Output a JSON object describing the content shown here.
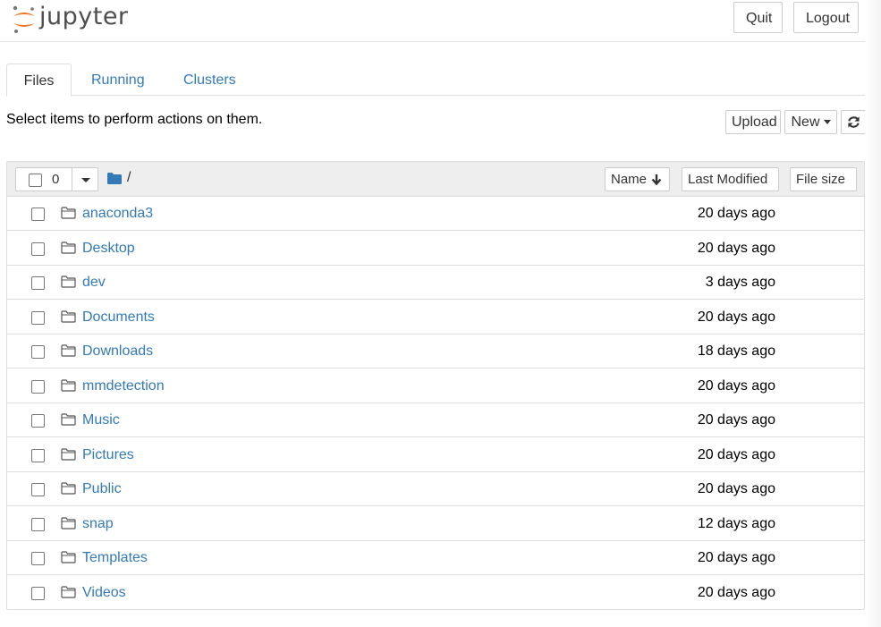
{
  "header": {
    "logo_text": "jupyter",
    "quit_label": "Quit",
    "logout_label": "Logout",
    "logo_colors": {
      "orange": "#f37726",
      "gray": "#767677"
    }
  },
  "tabs": [
    {
      "label": "Files",
      "active": true
    },
    {
      "label": "Running",
      "active": false
    },
    {
      "label": "Clusters",
      "active": false
    }
  ],
  "toolbar": {
    "instructions": "Select items to perform actions on them.",
    "upload_label": "Upload",
    "new_label": "New",
    "refresh_icon": "refresh-icon"
  },
  "file_list": {
    "selected_count": "0",
    "path": "/",
    "columns": {
      "name": "Name",
      "last_modified": "Last Modified",
      "file_size": "File size"
    },
    "items": [
      {
        "name": "anaconda3",
        "modified": "20 days ago",
        "icon": "folder-icon"
      },
      {
        "name": "Desktop",
        "modified": "20 days ago",
        "icon": "folder-icon"
      },
      {
        "name": "dev",
        "modified": "3 days ago",
        "icon": "folder-icon"
      },
      {
        "name": "Documents",
        "modified": "20 days ago",
        "icon": "folder-icon"
      },
      {
        "name": "Downloads",
        "modified": "18 days ago",
        "icon": "folder-icon"
      },
      {
        "name": "mmdetection",
        "modified": "20 days ago",
        "icon": "folder-icon"
      },
      {
        "name": "Music",
        "modified": "20 days ago",
        "icon": "folder-icon"
      },
      {
        "name": "Pictures",
        "modified": "20 days ago",
        "icon": "folder-icon"
      },
      {
        "name": "Public",
        "modified": "20 days ago",
        "icon": "folder-icon"
      },
      {
        "name": "snap",
        "modified": "12 days ago",
        "icon": "folder-icon"
      },
      {
        "name": "Templates",
        "modified": "20 days ago",
        "icon": "folder-icon"
      },
      {
        "name": "Videos",
        "modified": "20 days ago",
        "icon": "folder-icon"
      }
    ]
  },
  "colors": {
    "link": "#337ab7",
    "panel_header": "#eeeeee",
    "border": "#dddddd"
  }
}
